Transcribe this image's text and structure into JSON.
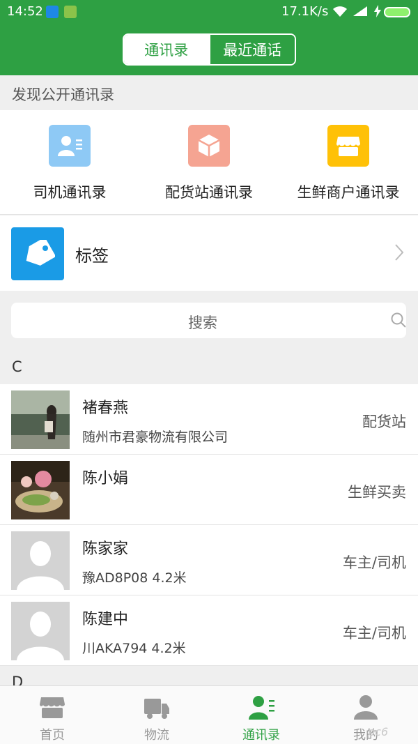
{
  "status_bar": {
    "time": "14:52",
    "network_speed": "17.1K/s",
    "icons": [
      "usb-icon",
      "android-icon",
      "wifi-icon",
      "signal-icon",
      "charging-icon",
      "battery-icon"
    ]
  },
  "header": {
    "tabs": [
      {
        "label": "通讯录",
        "active": true
      },
      {
        "label": "最近通话",
        "active": false
      }
    ],
    "accent_color": "#2ea043"
  },
  "discover": {
    "section_title": "发现公开通讯录",
    "directories": [
      {
        "label": "司机通讯录",
        "icon": "driver-card-icon",
        "color": "#8ec9f5"
      },
      {
        "label": "配货站通讯录",
        "icon": "cube-icon",
        "color": "#f5a492"
      },
      {
        "label": "生鲜商户通讯录",
        "icon": "shop-icon",
        "color": "#ffc107"
      }
    ]
  },
  "tags": {
    "label": "标签",
    "icon": "tag-icon",
    "color": "#1a9be6"
  },
  "search": {
    "placeholder": "搜索"
  },
  "contact_groups": [
    {
      "letter": "C",
      "contacts": [
        {
          "name": "褚春燕",
          "subtitle": "随州市君豪物流有限公司",
          "role": "配货站",
          "avatar": "photo-woman"
        },
        {
          "name": "陈小娟",
          "subtitle": "",
          "role": "生鲜买卖",
          "avatar": "photo-food"
        },
        {
          "name": "陈家家",
          "subtitle": "豫AD8P08 4.2米",
          "role": "车主/司机",
          "avatar": "placeholder"
        },
        {
          "name": "陈建中",
          "subtitle": "川AKA794 4.2米",
          "role": "车主/司机",
          "avatar": "placeholder"
        }
      ]
    },
    {
      "letter": "D",
      "contacts": []
    }
  ],
  "tabbar": {
    "tabs": [
      {
        "label": "首页",
        "icon": "store-icon",
        "active": false
      },
      {
        "label": "物流",
        "icon": "truck-icon",
        "active": false
      },
      {
        "label": "通讯录",
        "icon": "contacts-icon",
        "active": true
      },
      {
        "label": "我的",
        "icon": "profile-icon",
        "active": false
      }
    ]
  },
  "watermark": "pc6"
}
